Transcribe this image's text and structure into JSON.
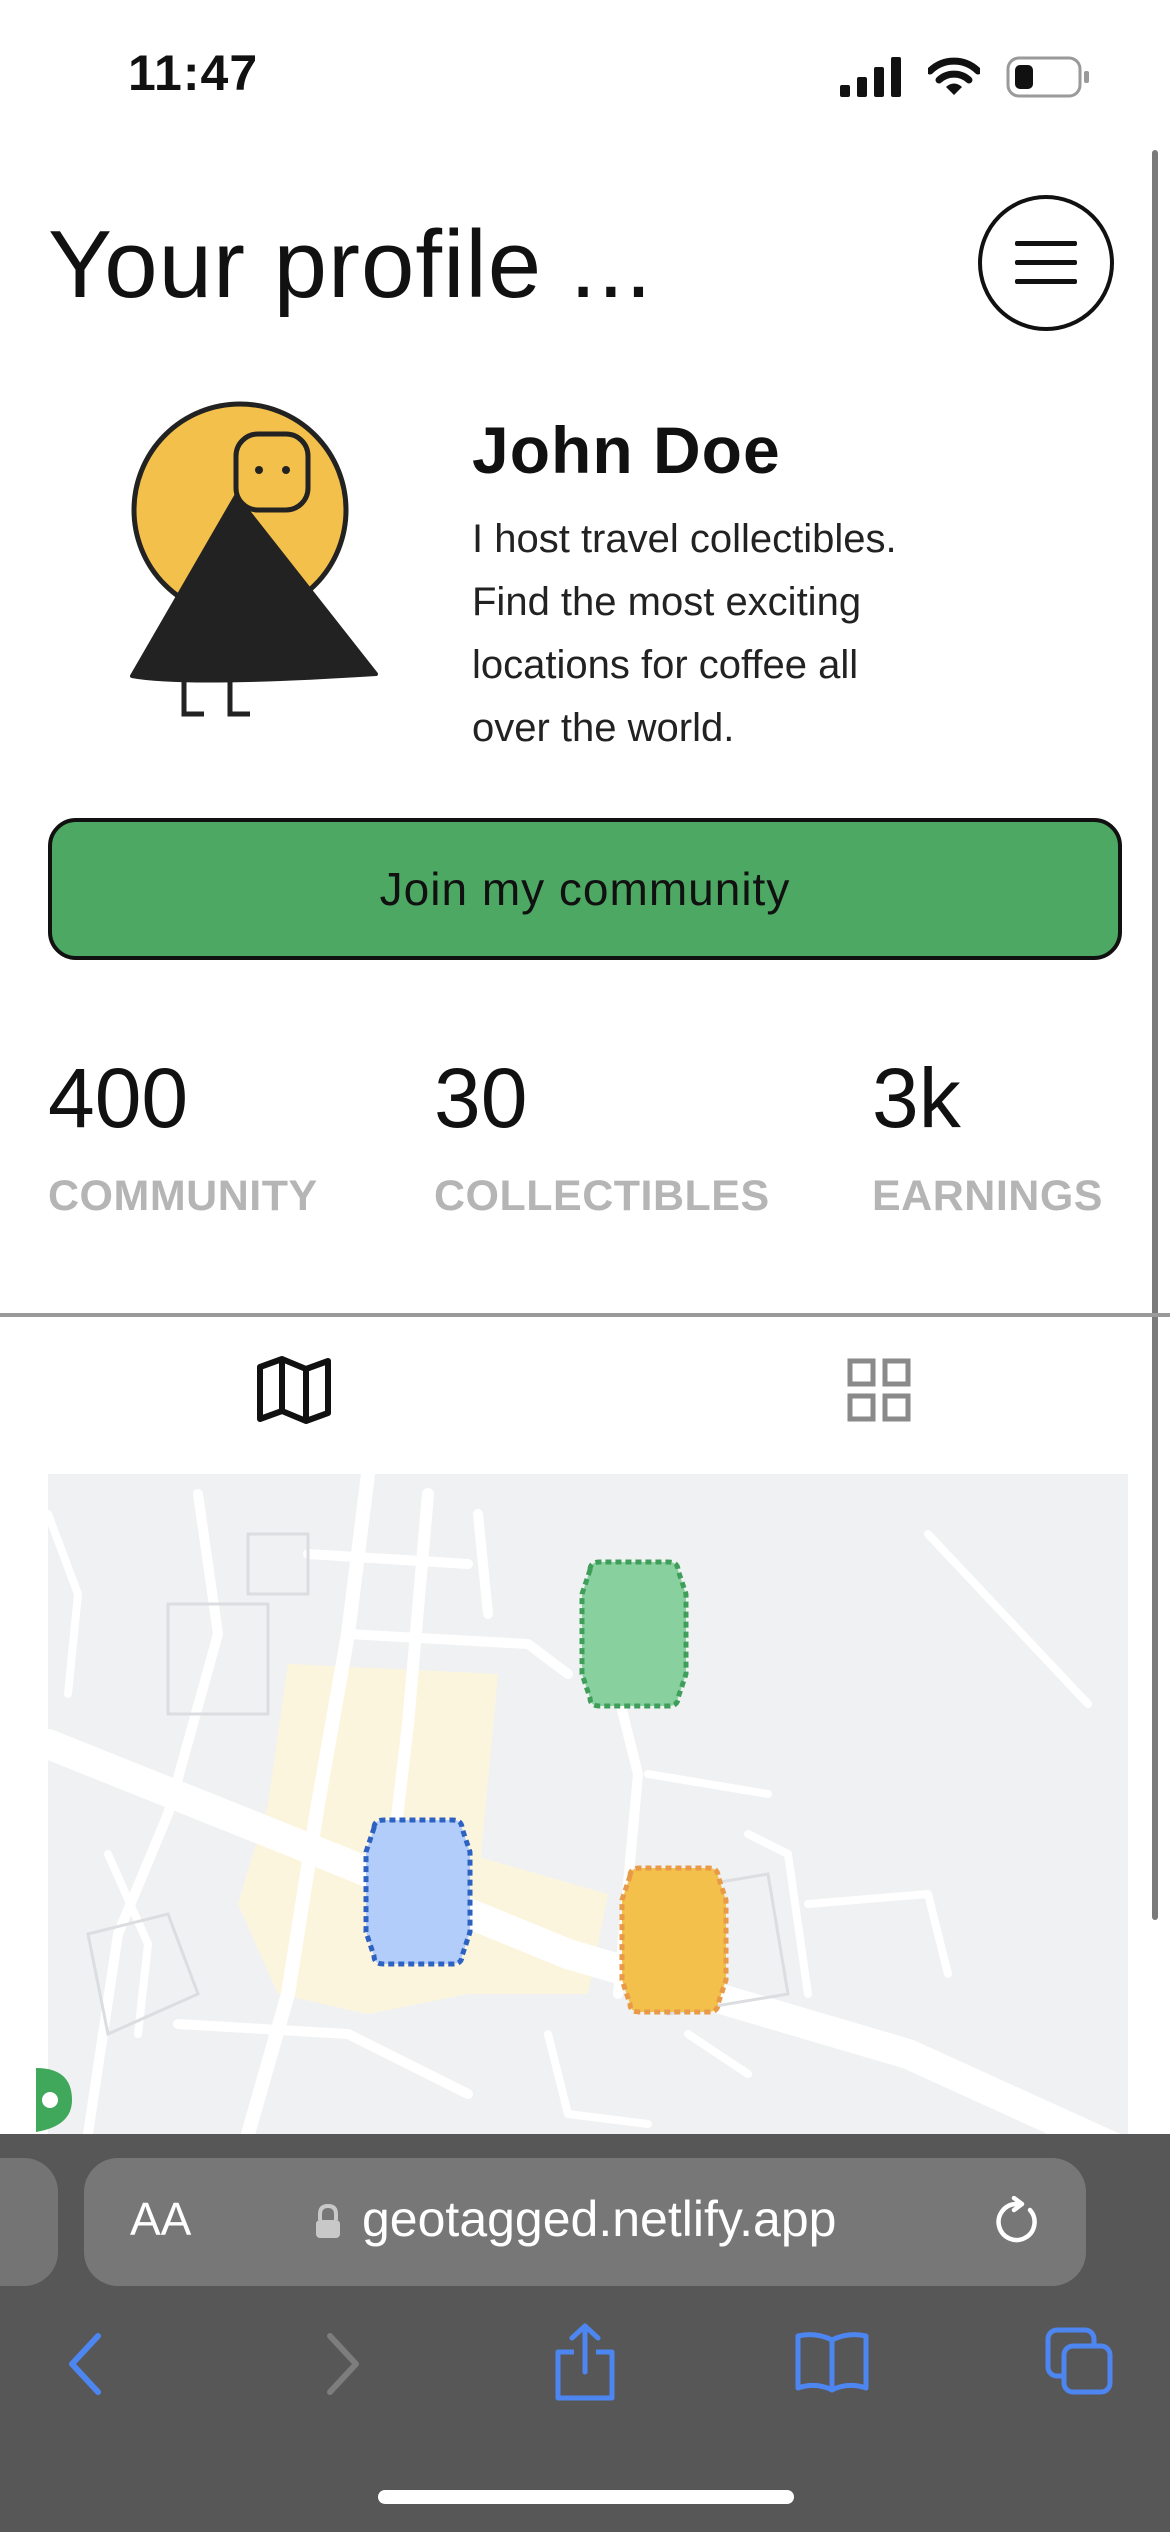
{
  "status": {
    "time": "11:47"
  },
  "header": {
    "title": "Your profile ..."
  },
  "profile": {
    "name": "John Doe",
    "bio_lines": [
      "I host travel collectibles.",
      "Find the most exciting",
      "locations for coffee all",
      "over the world."
    ]
  },
  "join_button": {
    "label": "Join my community"
  },
  "stats": [
    {
      "value": "400",
      "label": "COMMUNITY"
    },
    {
      "value": "30",
      "label": "COLLECTIBLES"
    },
    {
      "value": "3k",
      "label": "EARNINGS"
    }
  ],
  "tabs": {
    "map_icon": "map-icon",
    "grid_icon": "grid-icon"
  },
  "map": {
    "markers": [
      {
        "color": "#88d19f",
        "border": "#3f9e5a",
        "name": "green-marker"
      },
      {
        "color": "#b3cdfb",
        "border": "#2e62c2",
        "name": "blue-marker"
      },
      {
        "color": "#f4c04c",
        "border": "#e89a48",
        "name": "orange-marker"
      }
    ]
  },
  "browser": {
    "text_size_label": "AA",
    "url": "geotagged.netlify.app"
  },
  "colors": {
    "accent_green": "#4ca862",
    "avatar_yellow": "#f4c04c",
    "label_gray": "#b5b5b5",
    "ios_blue": "#4d86f0"
  }
}
